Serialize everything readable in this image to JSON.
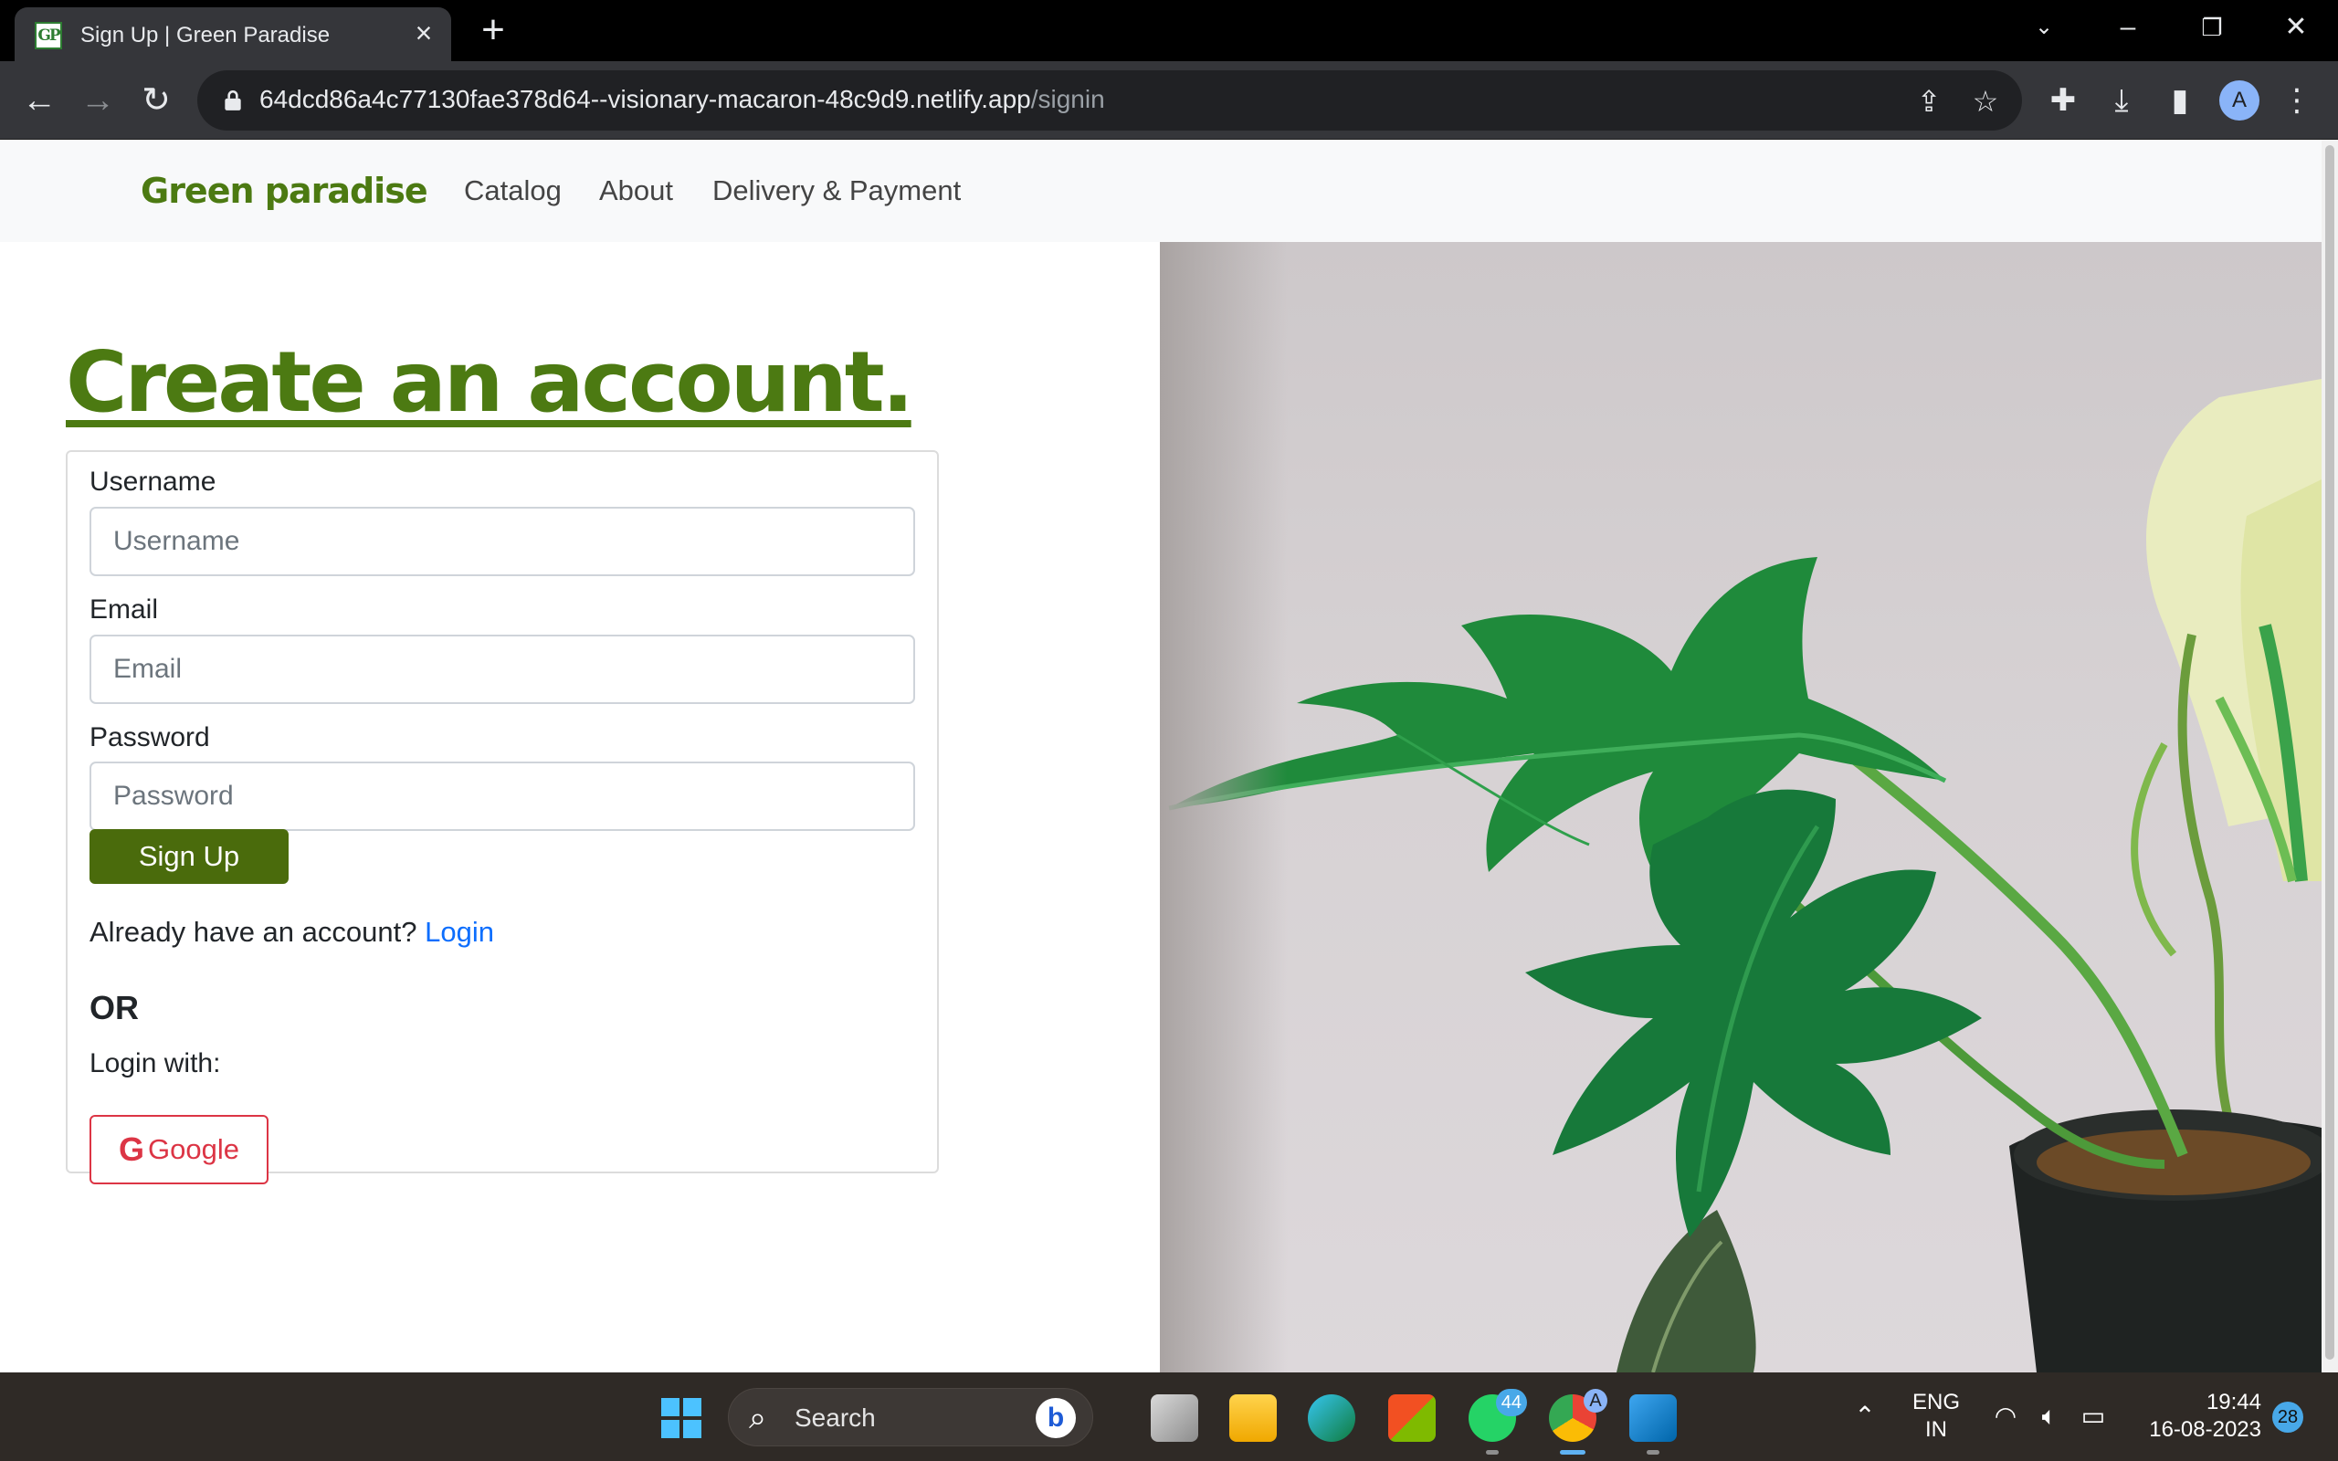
{
  "browser": {
    "tab": {
      "favicon_text": "GP",
      "title": "Sign Up | Green Paradise"
    },
    "url": {
      "host": "64dcd86a4c77130fae378d64--visionary-macaron-48c9d9.netlify.app",
      "path": "/signin"
    },
    "profile_initial": "A"
  },
  "site": {
    "brand": "Green paradise",
    "nav": [
      "Catalog",
      "About",
      "Delivery & Payment"
    ]
  },
  "signup": {
    "heading": "Create an account.",
    "username_label": "Username",
    "username_placeholder": "Username",
    "email_label": "Email",
    "email_placeholder": "Email",
    "password_label": "Password",
    "password_placeholder": "Password",
    "submit_label": "Sign Up",
    "already_text": "Already have an account?",
    "login_link": "Login",
    "or_text": "OR",
    "login_with": "Login with:",
    "google_label": "Google"
  },
  "taskbar": {
    "search_label": "Search",
    "whatsapp_badge": "44",
    "chrome_profile_badge": "A",
    "lang_line1": "ENG",
    "lang_line2": "IN",
    "time": "19:44",
    "date": "16-08-2023",
    "notifications": "28"
  },
  "colors": {
    "brand_green": "#4c7a12",
    "button_green": "#4a6b0c",
    "link_blue": "#0d6efd",
    "google_red": "#dc3545"
  }
}
